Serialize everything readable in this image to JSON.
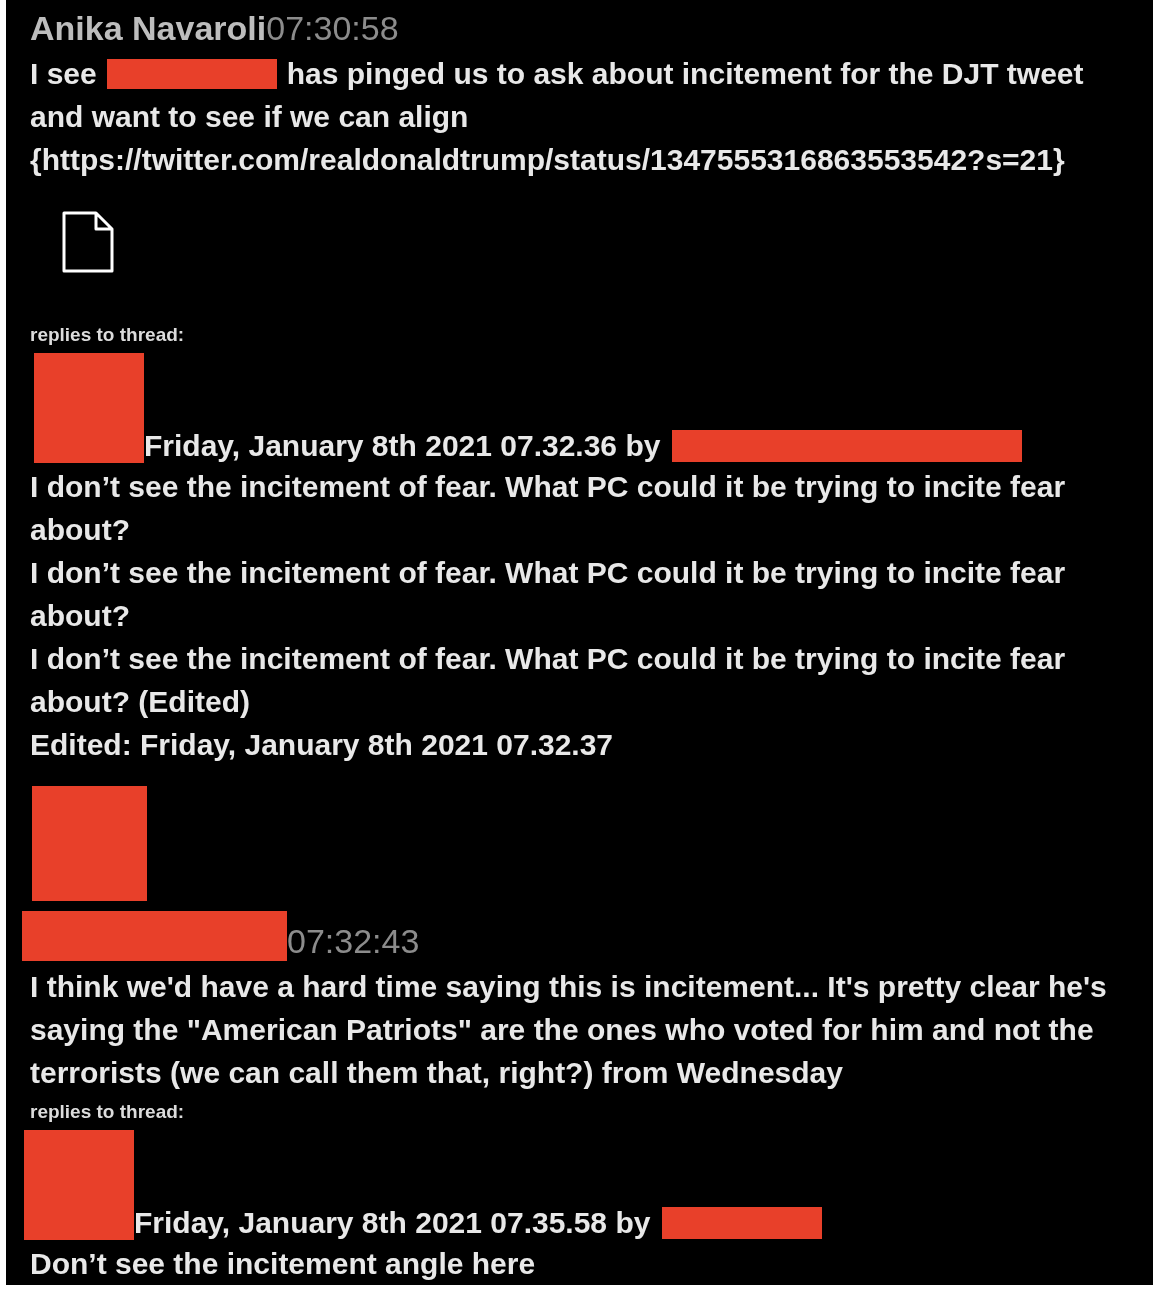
{
  "thread": [
    {
      "kind": "message",
      "author": "Anika Navaroli",
      "author_redacted": false,
      "avatar_redacted": false,
      "time": "07:30:58",
      "body": [
        {
          "kind": "text",
          "text": "I see"
        },
        {
          "kind": "redaction"
        },
        {
          "kind": "text",
          "text": "has pinged us to ask about incitement for the DJT tweet"
        },
        {
          "kind": "break"
        },
        {
          "kind": "text",
          "text": "and want to see if we can align"
        },
        {
          "kind": "break"
        },
        {
          "kind": "text",
          "text": "{https://twitter.com/realdonaldtrump/status/1347555316863553542?s=21}"
        }
      ],
      "attachment": {
        "kind": "file"
      },
      "replies": {
        "label": "replies to thread:",
        "items": [
          {
            "date": "Friday, January 8th 2021 07.32.36 by",
            "lines": [
              "I don’t see the incitement of fear. What PC could it be trying to incite fear about?",
              "I don’t see the incitement of fear. What PC could it be trying to incite fear about?",
              "I don’t see the incitement of fear. What PC could it be trying to incite fear about? (Edited)"
            ],
            "edited": "Edited: Friday, January 8th 2021 07.32.37"
          }
        ]
      }
    },
    {
      "kind": "message",
      "author_redacted": true,
      "avatar_redacted": true,
      "time": "07:32:43",
      "body": [
        {
          "kind": "text",
          "text": "I think we'd have a hard time saying this is incitement... It's pretty clear he's saying the \"American Patriots\" are the ones who voted for him and not the terrorists (we can call them that, right?) from Wednesday"
        }
      ],
      "replies": {
        "label": "replies to thread:",
        "items": [
          {
            "date": "Friday, January 8th 2021 07.35.58 by",
            "lines": [
              "Don’t see the incitement angle here"
            ]
          }
        ]
      }
    }
  ]
}
